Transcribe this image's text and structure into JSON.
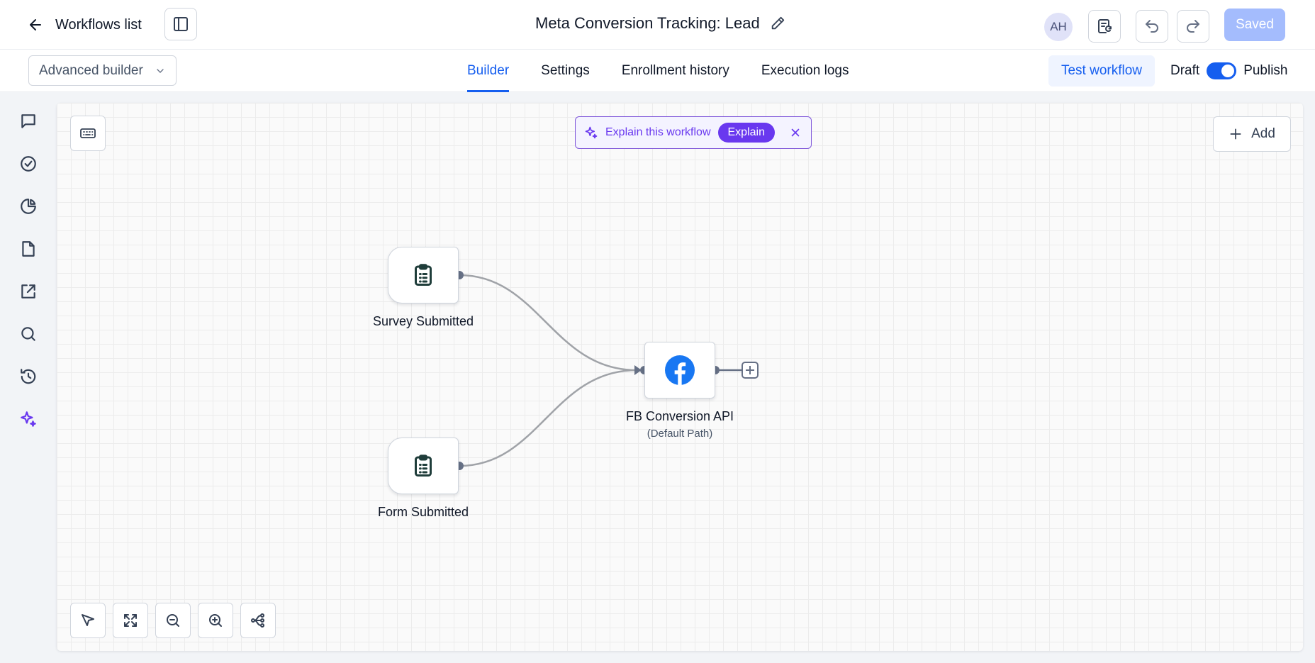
{
  "header": {
    "back_label": "Workflows list",
    "workflow_title": "Meta Conversion Tracking: Lead",
    "avatar_initials": "AH",
    "saved_label": "Saved"
  },
  "subbar": {
    "builder_mode": "Advanced builder",
    "tabs": [
      {
        "label": "Builder",
        "active": true
      },
      {
        "label": "Settings",
        "active": false
      },
      {
        "label": "Enrollment history",
        "active": false
      },
      {
        "label": "Execution logs",
        "active": false
      }
    ],
    "test_label": "Test workflow",
    "draft_label": "Draft",
    "publish_label": "Publish"
  },
  "sidebar": {
    "icons": [
      "chat-icon",
      "check-circle-icon",
      "pie-chart-icon",
      "document-icon",
      "external-link-icon",
      "search-icon",
      "history-icon",
      "sparkles-icon"
    ]
  },
  "canvas": {
    "explain_text": "Explain this workflow",
    "explain_button": "Explain",
    "add_label": "Add",
    "nodes": {
      "survey": {
        "label": "Survey Submitted"
      },
      "form": {
        "label": "Form Submitted"
      },
      "fb": {
        "label": "FB Conversion API",
        "sublabel": "(Default Path)"
      }
    }
  },
  "colors": {
    "accent": "#155eef",
    "ai_purple": "#6938ef",
    "facebook": "#1877f2"
  }
}
